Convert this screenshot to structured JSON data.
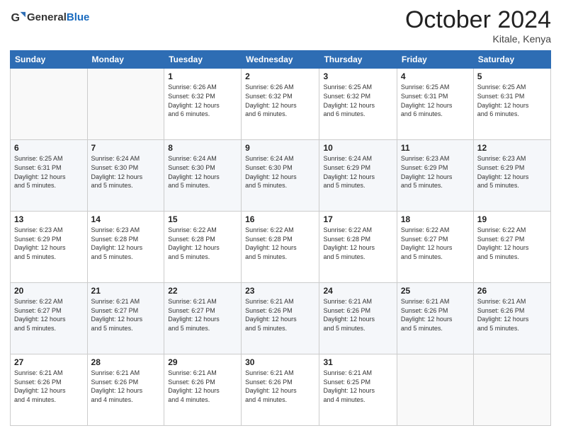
{
  "header": {
    "logo_general": "General",
    "logo_blue": "Blue",
    "title": "October 2024",
    "location": "Kitale, Kenya"
  },
  "columns": [
    "Sunday",
    "Monday",
    "Tuesday",
    "Wednesday",
    "Thursday",
    "Friday",
    "Saturday"
  ],
  "weeks": [
    [
      {
        "day": "",
        "info": ""
      },
      {
        "day": "",
        "info": ""
      },
      {
        "day": "1",
        "info": "Sunrise: 6:26 AM\nSunset: 6:32 PM\nDaylight: 12 hours\nand 6 minutes."
      },
      {
        "day": "2",
        "info": "Sunrise: 6:26 AM\nSunset: 6:32 PM\nDaylight: 12 hours\nand 6 minutes."
      },
      {
        "day": "3",
        "info": "Sunrise: 6:25 AM\nSunset: 6:32 PM\nDaylight: 12 hours\nand 6 minutes."
      },
      {
        "day": "4",
        "info": "Sunrise: 6:25 AM\nSunset: 6:31 PM\nDaylight: 12 hours\nand 6 minutes."
      },
      {
        "day": "5",
        "info": "Sunrise: 6:25 AM\nSunset: 6:31 PM\nDaylight: 12 hours\nand 6 minutes."
      }
    ],
    [
      {
        "day": "6",
        "info": "Sunrise: 6:25 AM\nSunset: 6:31 PM\nDaylight: 12 hours\nand 5 minutes."
      },
      {
        "day": "7",
        "info": "Sunrise: 6:24 AM\nSunset: 6:30 PM\nDaylight: 12 hours\nand 5 minutes."
      },
      {
        "day": "8",
        "info": "Sunrise: 6:24 AM\nSunset: 6:30 PM\nDaylight: 12 hours\nand 5 minutes."
      },
      {
        "day": "9",
        "info": "Sunrise: 6:24 AM\nSunset: 6:30 PM\nDaylight: 12 hours\nand 5 minutes."
      },
      {
        "day": "10",
        "info": "Sunrise: 6:24 AM\nSunset: 6:29 PM\nDaylight: 12 hours\nand 5 minutes."
      },
      {
        "day": "11",
        "info": "Sunrise: 6:23 AM\nSunset: 6:29 PM\nDaylight: 12 hours\nand 5 minutes."
      },
      {
        "day": "12",
        "info": "Sunrise: 6:23 AM\nSunset: 6:29 PM\nDaylight: 12 hours\nand 5 minutes."
      }
    ],
    [
      {
        "day": "13",
        "info": "Sunrise: 6:23 AM\nSunset: 6:29 PM\nDaylight: 12 hours\nand 5 minutes."
      },
      {
        "day": "14",
        "info": "Sunrise: 6:23 AM\nSunset: 6:28 PM\nDaylight: 12 hours\nand 5 minutes."
      },
      {
        "day": "15",
        "info": "Sunrise: 6:22 AM\nSunset: 6:28 PM\nDaylight: 12 hours\nand 5 minutes."
      },
      {
        "day": "16",
        "info": "Sunrise: 6:22 AM\nSunset: 6:28 PM\nDaylight: 12 hours\nand 5 minutes."
      },
      {
        "day": "17",
        "info": "Sunrise: 6:22 AM\nSunset: 6:28 PM\nDaylight: 12 hours\nand 5 minutes."
      },
      {
        "day": "18",
        "info": "Sunrise: 6:22 AM\nSunset: 6:27 PM\nDaylight: 12 hours\nand 5 minutes."
      },
      {
        "day": "19",
        "info": "Sunrise: 6:22 AM\nSunset: 6:27 PM\nDaylight: 12 hours\nand 5 minutes."
      }
    ],
    [
      {
        "day": "20",
        "info": "Sunrise: 6:22 AM\nSunset: 6:27 PM\nDaylight: 12 hours\nand 5 minutes."
      },
      {
        "day": "21",
        "info": "Sunrise: 6:21 AM\nSunset: 6:27 PM\nDaylight: 12 hours\nand 5 minutes."
      },
      {
        "day": "22",
        "info": "Sunrise: 6:21 AM\nSunset: 6:27 PM\nDaylight: 12 hours\nand 5 minutes."
      },
      {
        "day": "23",
        "info": "Sunrise: 6:21 AM\nSunset: 6:26 PM\nDaylight: 12 hours\nand 5 minutes."
      },
      {
        "day": "24",
        "info": "Sunrise: 6:21 AM\nSunset: 6:26 PM\nDaylight: 12 hours\nand 5 minutes."
      },
      {
        "day": "25",
        "info": "Sunrise: 6:21 AM\nSunset: 6:26 PM\nDaylight: 12 hours\nand 5 minutes."
      },
      {
        "day": "26",
        "info": "Sunrise: 6:21 AM\nSunset: 6:26 PM\nDaylight: 12 hours\nand 5 minutes."
      }
    ],
    [
      {
        "day": "27",
        "info": "Sunrise: 6:21 AM\nSunset: 6:26 PM\nDaylight: 12 hours\nand 4 minutes."
      },
      {
        "day": "28",
        "info": "Sunrise: 6:21 AM\nSunset: 6:26 PM\nDaylight: 12 hours\nand 4 minutes."
      },
      {
        "day": "29",
        "info": "Sunrise: 6:21 AM\nSunset: 6:26 PM\nDaylight: 12 hours\nand 4 minutes."
      },
      {
        "day": "30",
        "info": "Sunrise: 6:21 AM\nSunset: 6:26 PM\nDaylight: 12 hours\nand 4 minutes."
      },
      {
        "day": "31",
        "info": "Sunrise: 6:21 AM\nSunset: 6:25 PM\nDaylight: 12 hours\nand 4 minutes."
      },
      {
        "day": "",
        "info": ""
      },
      {
        "day": "",
        "info": ""
      }
    ]
  ]
}
